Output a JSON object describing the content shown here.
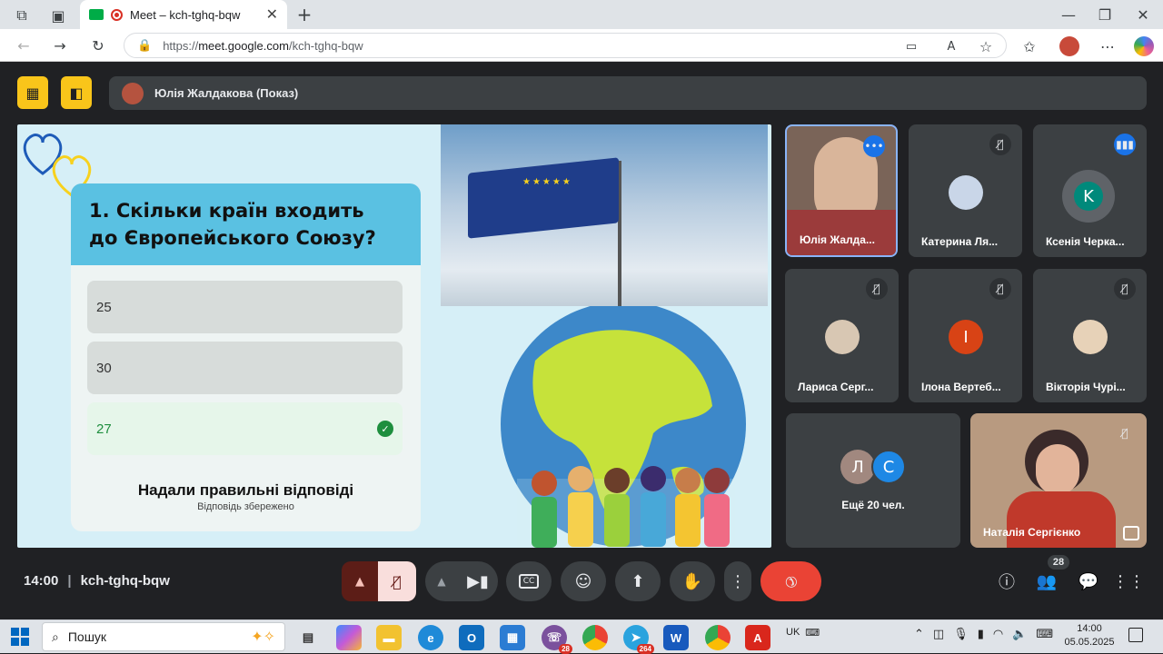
{
  "browser": {
    "tab_title": "Meet – kch-tghq-bqw",
    "url_prefix": "https://",
    "url_host": "meet.google.com",
    "url_path": "/kch-tghq-bqw"
  },
  "meet": {
    "presenter_label": "Юлія Жалдакова (Показ)",
    "time": "14:00",
    "meeting_code": "kch-tghq-bqw",
    "participant_count": "28"
  },
  "slide": {
    "question": "1. Скільки країн входить до Європейського Союзу?",
    "options": [
      {
        "label": "25",
        "correct": false
      },
      {
        "label": "30",
        "correct": false
      },
      {
        "label": "27",
        "correct": true
      }
    ],
    "result_title": "Надали правильні відповіді",
    "result_sub": "Відповідь збережено"
  },
  "tiles": [
    {
      "name": "Юлія Жалда...",
      "initial": "",
      "icon": "more-icon"
    },
    {
      "name": "Катерина Ля...",
      "initial": "",
      "icon": "mic-off-icon"
    },
    {
      "name": "Ксенія Черка...",
      "initial": "K",
      "icon": "speaking-icon"
    },
    {
      "name": "Лариса Серг...",
      "initial": "",
      "icon": "mic-off-icon"
    },
    {
      "name": "Ілона Вертеб...",
      "initial": "І",
      "icon": "mic-off-icon"
    },
    {
      "name": "Вікторія Чурі...",
      "initial": "",
      "icon": "mic-off-icon"
    },
    {
      "name": "Ещё 20 чел.",
      "initials": [
        "Л",
        "С"
      ]
    },
    {
      "name": "Наталія Сергієнко",
      "icon": "mic-off-icon"
    }
  ],
  "taskbar": {
    "search_placeholder": "Пошук",
    "lang": "UK",
    "clock_time": "14:00",
    "clock_date": "05.05.2025",
    "viber_badge": "28",
    "telegram_badge": "264"
  },
  "colors": {
    "meet_bg": "#202124",
    "accent_yellow": "#f9c51a",
    "end_call": "#ea4335",
    "correct": "#1e8e3e",
    "quiz_header": "#5ac1e2"
  }
}
